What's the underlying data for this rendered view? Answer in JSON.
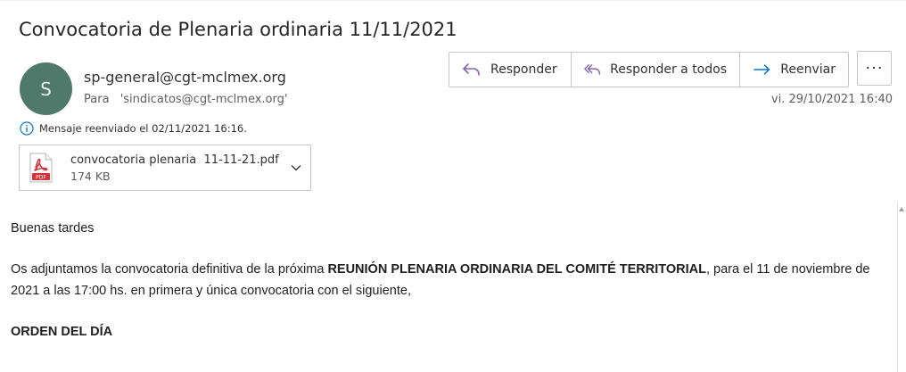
{
  "message": {
    "subject": "Convocatoria de Plenaria ordinaria 11/11/2021",
    "avatar_initial": "S",
    "avatar_color": "#4f7a6b",
    "sender": "sp-general@cgt-mclmex.org",
    "to_label": "Para",
    "to_value": "'sindicatos@cgt-mclmex.org'",
    "date": "vi. 29/10/2021 16:40",
    "forward_note": "Mensaje reenviado el 02/11/2021 16:16."
  },
  "toolbar": {
    "reply_label": "Responder",
    "reply_all_label": "Responder a todos",
    "forward_label": "Reenviar",
    "more_label": "···",
    "accent_color": "#8764b8",
    "forward_color": "#0078d4"
  },
  "attachment": {
    "name": "convocatoria plenaria  11-11-21.pdf",
    "size": "174 KB",
    "icon": "pdf-icon",
    "icon_text": "PDF"
  },
  "body": {
    "greeting": "Buenas tardes",
    "para_before": "Os adjuntamos la convocatoria definitiva de la próxima ",
    "para_bold": "REUNIÓN PLENARIA ORDINARIA DEL COMITÉ TERRITORIAL",
    "para_after": ", para el 11 de noviembre de 2021 a las 17:00 hs. en primera y única convocatoria con el siguiente,",
    "heading": "ORDEN DEL DÍA"
  }
}
